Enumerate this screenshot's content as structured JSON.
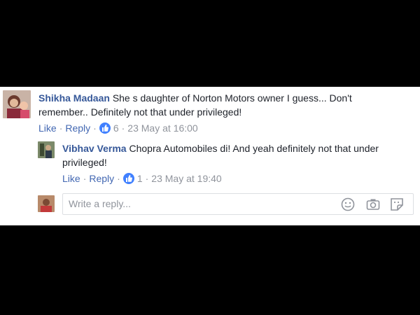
{
  "comment": {
    "author": "Shikha Madaan",
    "text": "She s daughter of Norton Motors owner I guess... Don't remember.. Definitely not that under privileged!",
    "like_label": "Like",
    "reply_label": "Reply",
    "separator": "·",
    "reaction_count": "6",
    "timestamp": "23 May at 16:00"
  },
  "reply": {
    "author": "Vibhav Verma",
    "text": "Chopra Automobiles di! And yeah definitely not that under privileged!",
    "like_label": "Like",
    "reply_label": "Reply",
    "separator": "·",
    "reaction_count": "1",
    "timestamp": "23 May at 19:40"
  },
  "composer": {
    "placeholder": "Write a reply...",
    "icons": [
      "emoji-icon",
      "camera-icon",
      "sticker-icon"
    ]
  },
  "colors": {
    "author": "#365899",
    "action_link": "#4267b2",
    "like_badge": "#4080ff",
    "muted": "#90949c"
  }
}
